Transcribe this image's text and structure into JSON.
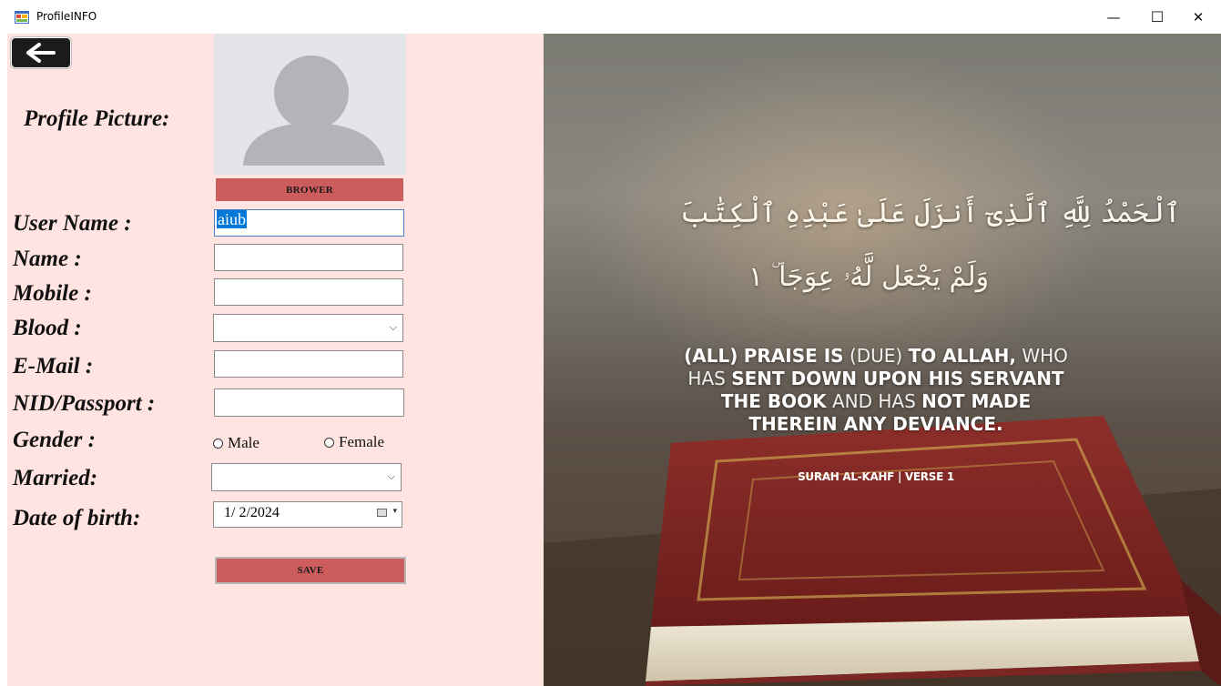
{
  "window": {
    "title": "ProfileINFO",
    "minimize_glyph": "—",
    "maximize_glyph": "☐",
    "close_glyph": "✕"
  },
  "form": {
    "back_glyph": "←",
    "labels": {
      "profile_picture": "Profile Picture:",
      "user_name": "User Name :",
      "name": "Name  :",
      "mobile": "Mobile  :",
      "blood": "Blood   :",
      "email": "E-Mail  :",
      "nid": "NID/Passport :",
      "gender": "Gender :",
      "married": "Married:",
      "dob": "Date of birth:"
    },
    "browse_label": "BROWER",
    "save_label": "SAVE",
    "user_name_value": "aiub",
    "name_value": "",
    "mobile_value": "",
    "blood_value": "",
    "email_value": "",
    "nid_value": "",
    "married_value": "",
    "gender_options": [
      "Male",
      "Female"
    ],
    "dob_value": "1/  2/2024"
  },
  "image": {
    "arabic_line1": "ٱلْحَمْدُ لِلَّهِ ٱلَّذِىٓ أَنزَلَ عَلَىٰ عَبْدِهِ ٱلْكِتَٰبَ",
    "arabic_line2": "وَلَمْ يَجْعَل لَّهُۥ عِوَجَا ۜ ١",
    "english_parts": {
      "p1": "(ALL)",
      "p2": "PRAISE IS",
      "p3": "(DUE)",
      "p4": "TO ALLAH,",
      "p5": "WHO",
      "p6": "HAS",
      "p7": "SENT DOWN UPON HIS SERVANT",
      "p8": "THE BOOK",
      "p9": "AND HAS",
      "p10": "NOT MADE",
      "p11": "THEREIN ANY DEVIANCE."
    },
    "verse_ref": "SURAH AL-KAHF | VERSE 1"
  }
}
